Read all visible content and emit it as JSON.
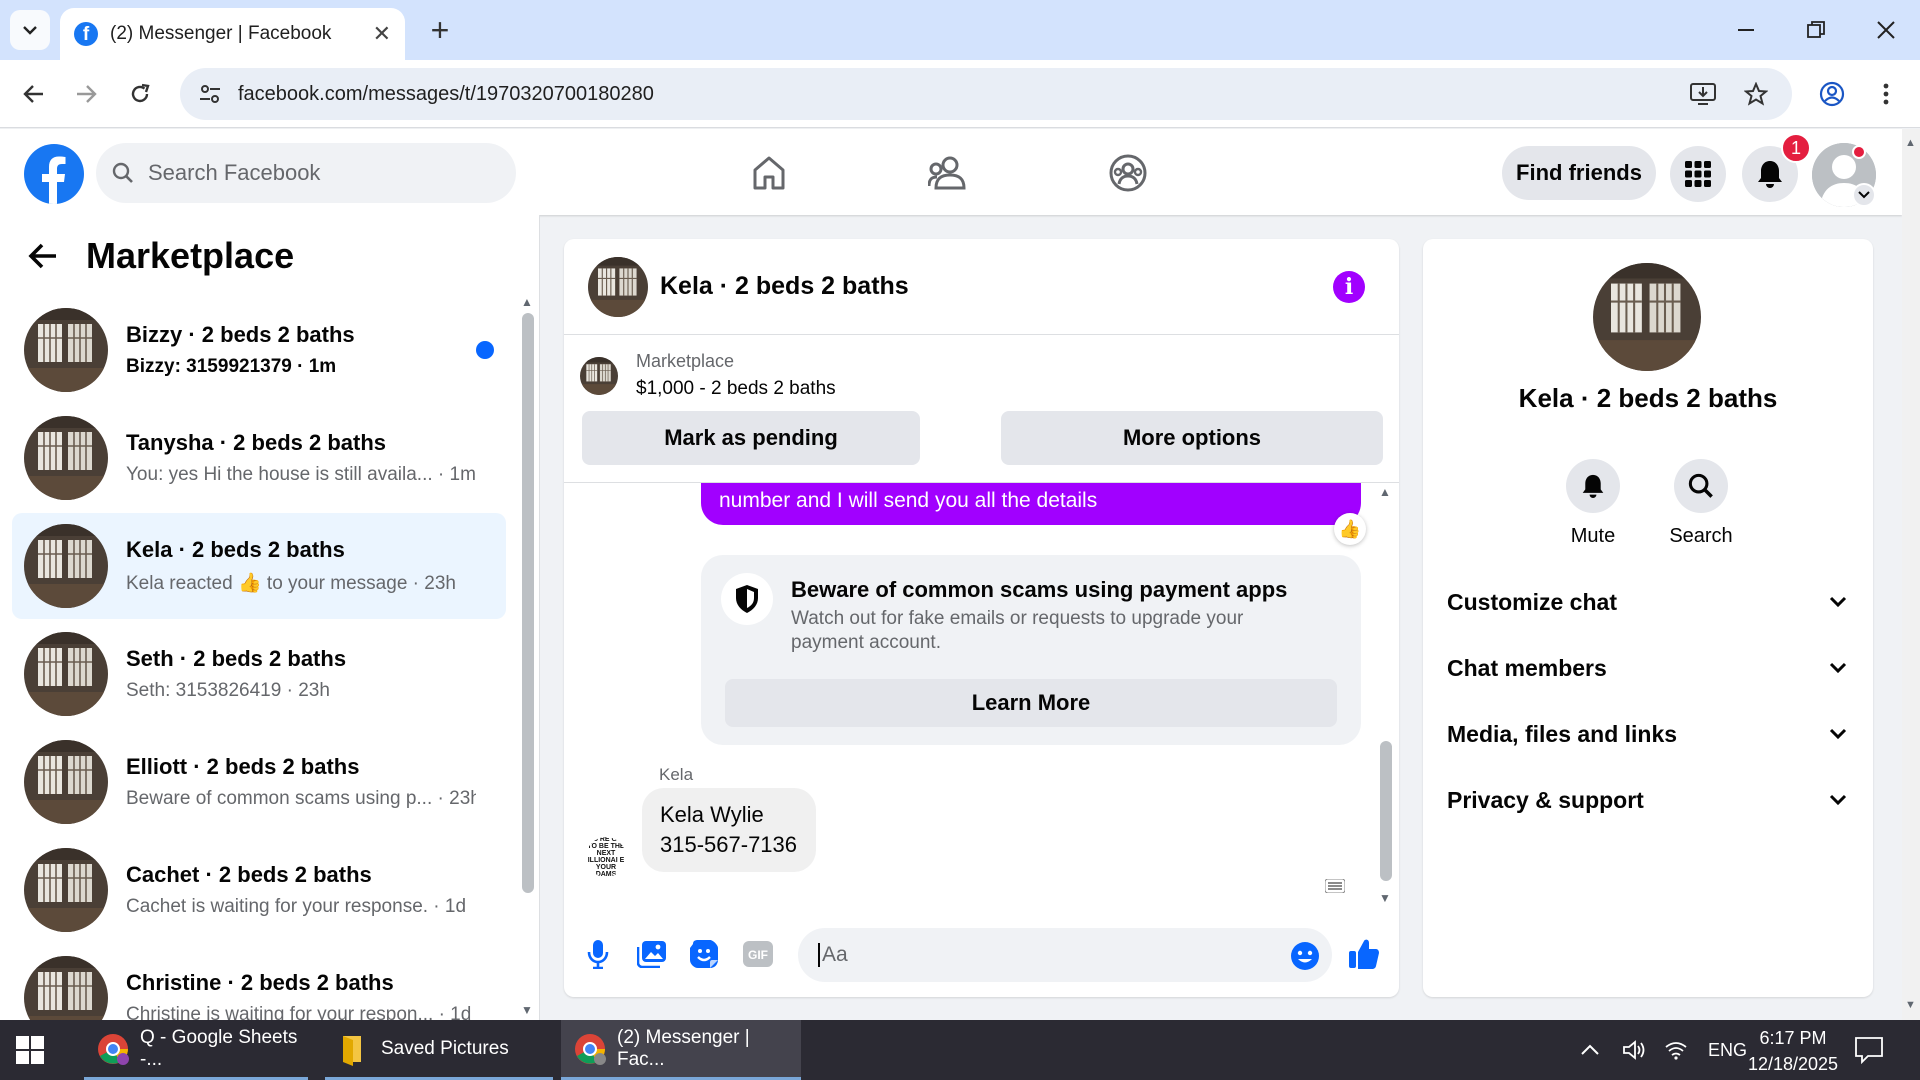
{
  "browser": {
    "tab_title": "(2) Messenger | Facebook",
    "new_tab": "+",
    "url": "facebook.com/messages/t/1970320700180280"
  },
  "facebook": {
    "search_placeholder": "Search Facebook",
    "find_friends": "Find friends",
    "notification_count": "1"
  },
  "sidebar": {
    "title": "Marketplace",
    "conversations": [
      {
        "name": "Bizzy · 2 beds 2 baths",
        "preview": "Bizzy: 3159921379 · 1m",
        "unread": true,
        "active": false
      },
      {
        "name": "Tanysha · 2 beds 2 baths",
        "preview": "You: yes Hi the house is still availa... · 1m",
        "unread": false,
        "active": false
      },
      {
        "name": "Kela · 2 beds 2 baths",
        "preview_before": "Kela reacted",
        "preview_emoji": "👍",
        "preview_after": "to your message · 23h",
        "unread": false,
        "active": true
      },
      {
        "name": "Seth · 2 beds 2 baths",
        "preview": "Seth: 3153826419 · 23h",
        "unread": false,
        "active": false
      },
      {
        "name": "Elliott · 2 beds 2 baths",
        "preview": "Beware of common scams using p... · 23h",
        "unread": false,
        "active": false
      },
      {
        "name": "Cachet · 2 beds 2 baths",
        "preview": "Cachet is waiting for your response. · 1d",
        "unread": false,
        "active": false
      },
      {
        "name": "Christine · 2 beds 2 baths",
        "preview": "Christine is waiting for your respon... · 1d",
        "unread": false,
        "active": false
      }
    ]
  },
  "chat": {
    "title": "Kela · 2 beds 2 baths",
    "marketplace_label": "Marketplace",
    "listing": "$1,000 - 2 beds 2 baths",
    "mark_pending": "Mark as pending",
    "more_options": "More options",
    "outgoing_message": "number and I will send you all the details",
    "outgoing_reaction": "👍",
    "scam_title": "Beware of common scams using payment apps",
    "scam_body": "Watch out for fake emails or requests to upgrade your payment account.",
    "learn_more": "Learn More",
    "incoming_sender": "Kela",
    "incoming_line1": "Kela Wylie",
    "incoming_line2": "315-567-7136",
    "incoming_avatar_text": "OU'RE GOI TO BE THE NEXT ILLIONAI E YOUR DAMS",
    "composer_placeholder": "Aa"
  },
  "right_panel": {
    "name": "Kela · 2 beds 2 baths",
    "mute": "Mute",
    "search": "Search",
    "sections": [
      "Customize chat",
      "Chat members",
      "Media, files and links",
      "Privacy & support"
    ]
  },
  "taskbar": {
    "items": [
      "Q - Google Sheets -...",
      "Saved Pictures",
      "(2) Messenger | Fac..."
    ],
    "language": "ENG",
    "time": "6:17 PM",
    "date": "12/18/2025"
  },
  "colors": {
    "fb_blue": "#1877f2",
    "messenger_purple": "#a100ff",
    "unread_blue": "#0866ff",
    "active_row": "#ebf5ff"
  }
}
